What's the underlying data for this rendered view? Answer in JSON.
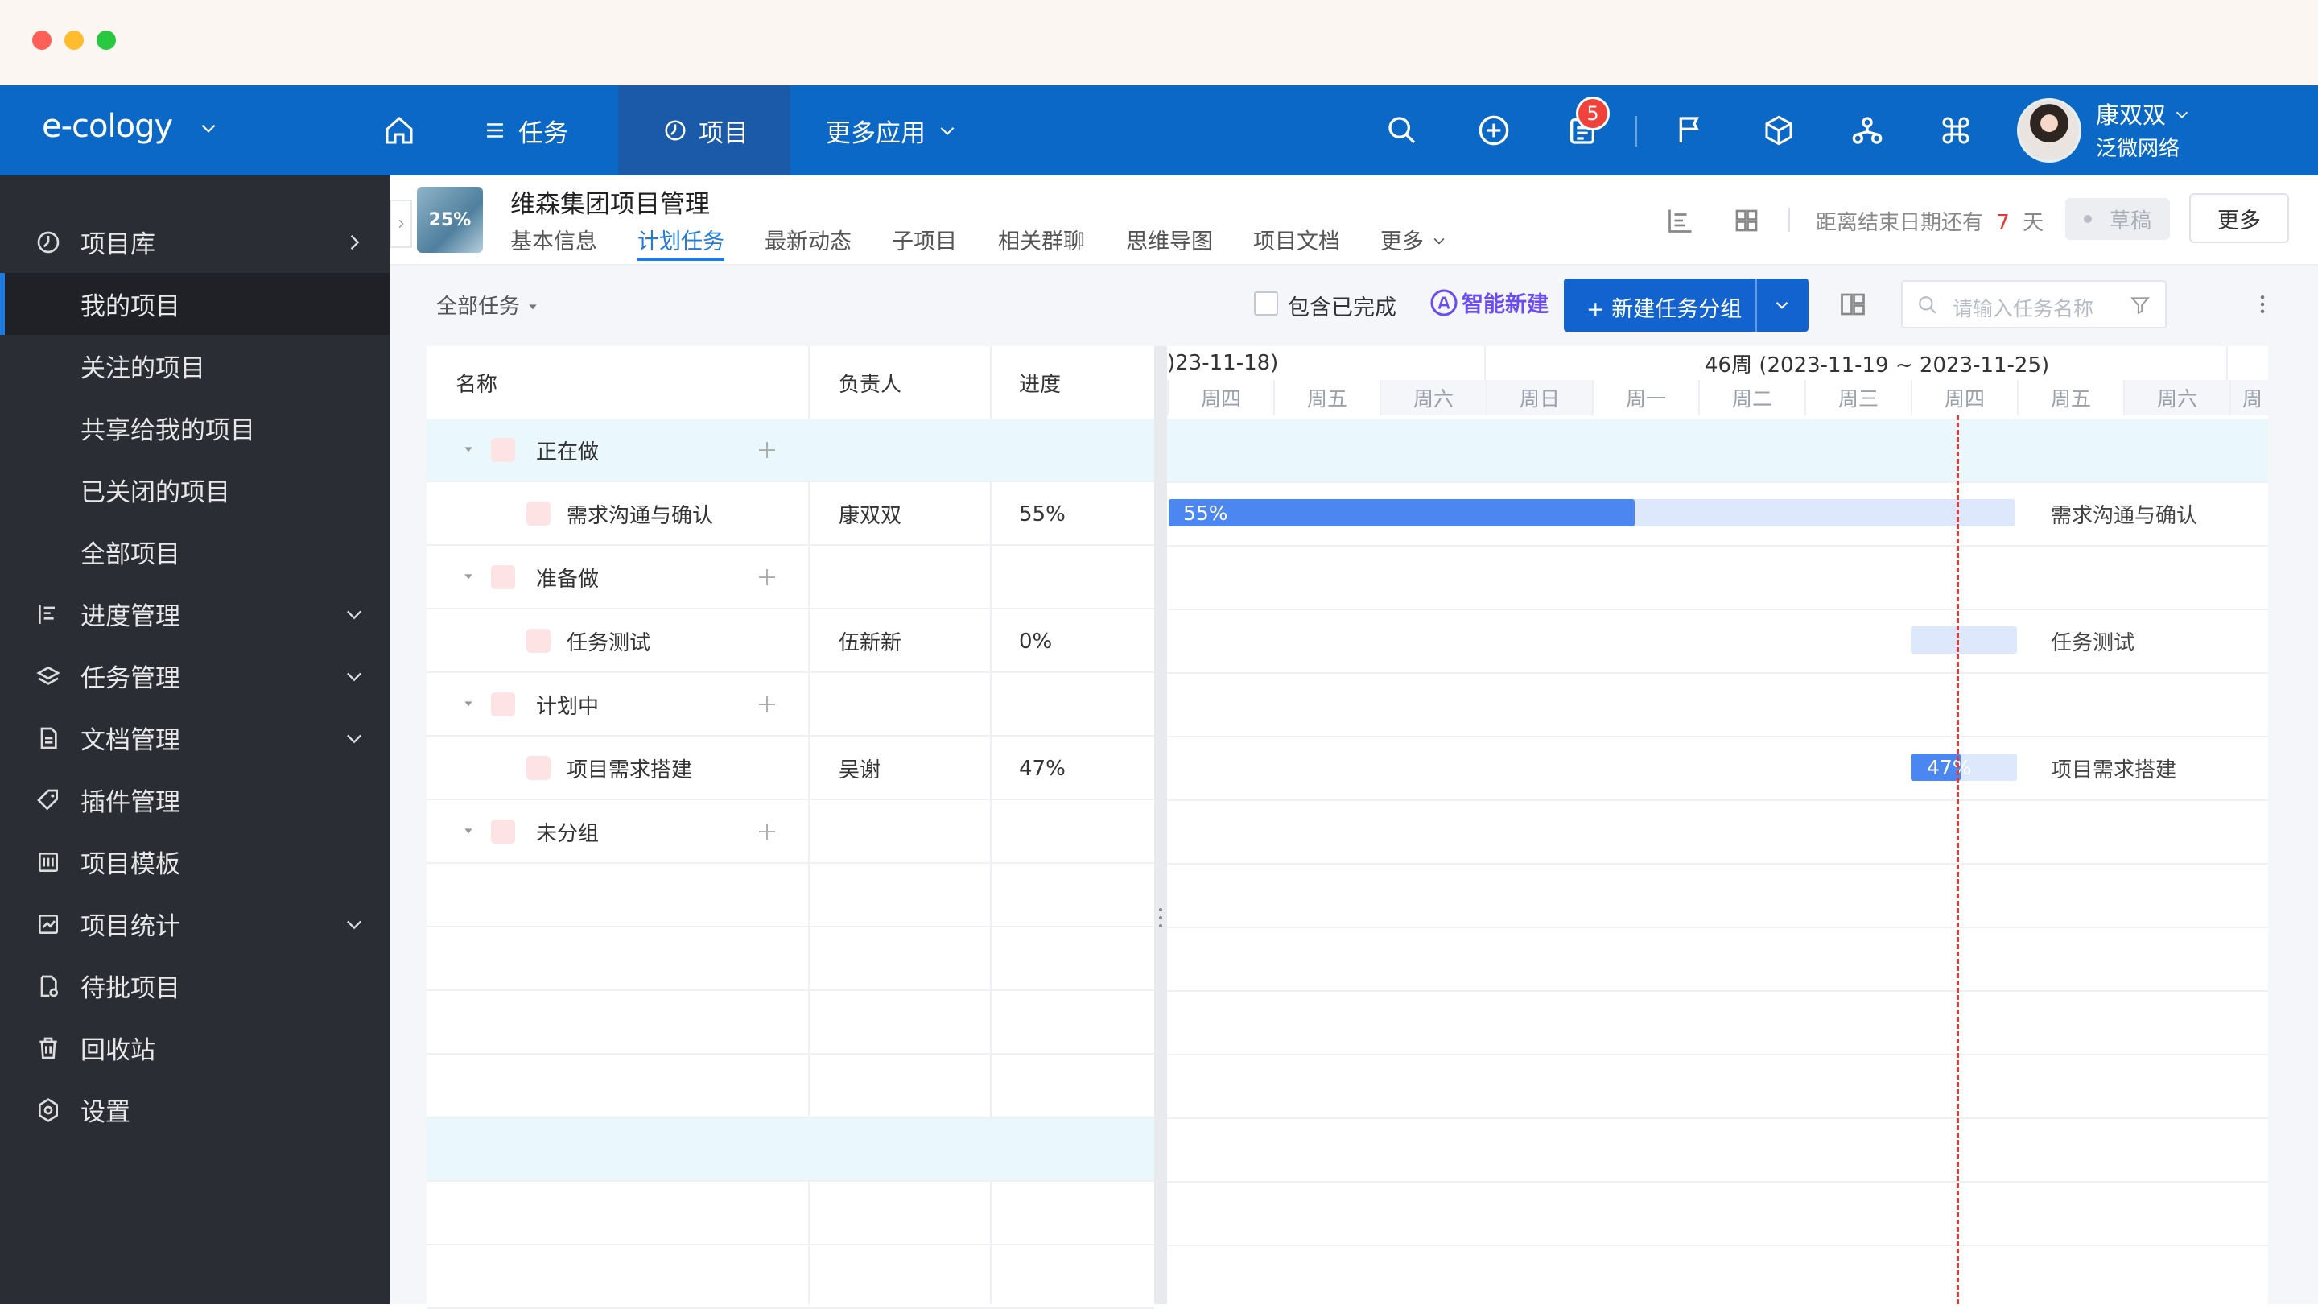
{
  "window": {
    "traffic_lights": [
      "#fe5f57",
      "#febc2e",
      "#28c840"
    ]
  },
  "topnav": {
    "logo": "e-cology",
    "items": [
      {
        "label": "任务",
        "icon": "list-icon"
      },
      {
        "label": "项目",
        "icon": "project-icon"
      },
      {
        "label": "更多应用",
        "icon": "chevron-down-icon"
      }
    ],
    "notification_count": "5",
    "user": {
      "name": "康双双",
      "company": "泛微网络"
    }
  },
  "sidebar": {
    "items": [
      {
        "label": "项目库"
      },
      {
        "label": "我的项目"
      },
      {
        "label": "关注的项目"
      },
      {
        "label": "共享给我的项目"
      },
      {
        "label": "已关闭的项目"
      },
      {
        "label": "全部项目"
      },
      {
        "label": "进度管理"
      },
      {
        "label": "任务管理"
      },
      {
        "label": "文档管理"
      },
      {
        "label": "插件管理"
      },
      {
        "label": "项目模板"
      },
      {
        "label": "项目统计"
      },
      {
        "label": "待批项目"
      },
      {
        "label": "回收站"
      },
      {
        "label": "设置"
      }
    ]
  },
  "project": {
    "progress": "25%",
    "title": "维森集团项目管理",
    "tabs": [
      "基本信息",
      "计划任务",
      "最新动态",
      "子项目",
      "相关群聊",
      "思维导图",
      "项目文档",
      "更多"
    ],
    "deadline_prefix": "距离结束日期还有",
    "deadline_days": "7",
    "deadline_unit": "天",
    "status": "草稿",
    "more_button": "更多"
  },
  "toolbar": {
    "filter": "全部任务",
    "include_done": "包含已完成",
    "ai_new": "智能新建",
    "new_group": "+ 新建任务分组",
    "search_placeholder": "请输入任务名称"
  },
  "table": {
    "headers": {
      "name": "名称",
      "owner": "负责人",
      "progress": "进度"
    },
    "groups": [
      {
        "name": "正在做",
        "tasks": [
          {
            "name": "需求沟通与确认",
            "owner": "康双双",
            "progress": "55%"
          }
        ]
      },
      {
        "name": "准备做",
        "tasks": [
          {
            "name": "任务测试",
            "owner": "伍新新",
            "progress": "0%"
          }
        ]
      },
      {
        "name": "计划中",
        "tasks": [
          {
            "name": "项目需求搭建",
            "owner": "吴谢",
            "progress": "47%"
          }
        ]
      },
      {
        "name": "未分组",
        "tasks": []
      }
    ]
  },
  "gantt": {
    "week_prev": ")23-11-18)",
    "week_current": "46周 (2023-11-19 ~ 2023-11-25)",
    "days": [
      "周四",
      "周五",
      "周六",
      "周日",
      "周一",
      "周二",
      "周三",
      "周四",
      "周五",
      "周六",
      "周"
    ],
    "bars": [
      {
        "label": "需求沟通与确认",
        "progress": "55%",
        "progress_value": 0.55
      },
      {
        "label": "任务测试",
        "progress": "",
        "progress_value": 0
      },
      {
        "label": "项目需求搭建",
        "progress": "47%",
        "progress_value": 0.47
      }
    ]
  },
  "colors": {
    "brand": "#0b68c6",
    "accent": "#1f7be0",
    "today_line": "#e53935",
    "badge": "#f0413b"
  }
}
